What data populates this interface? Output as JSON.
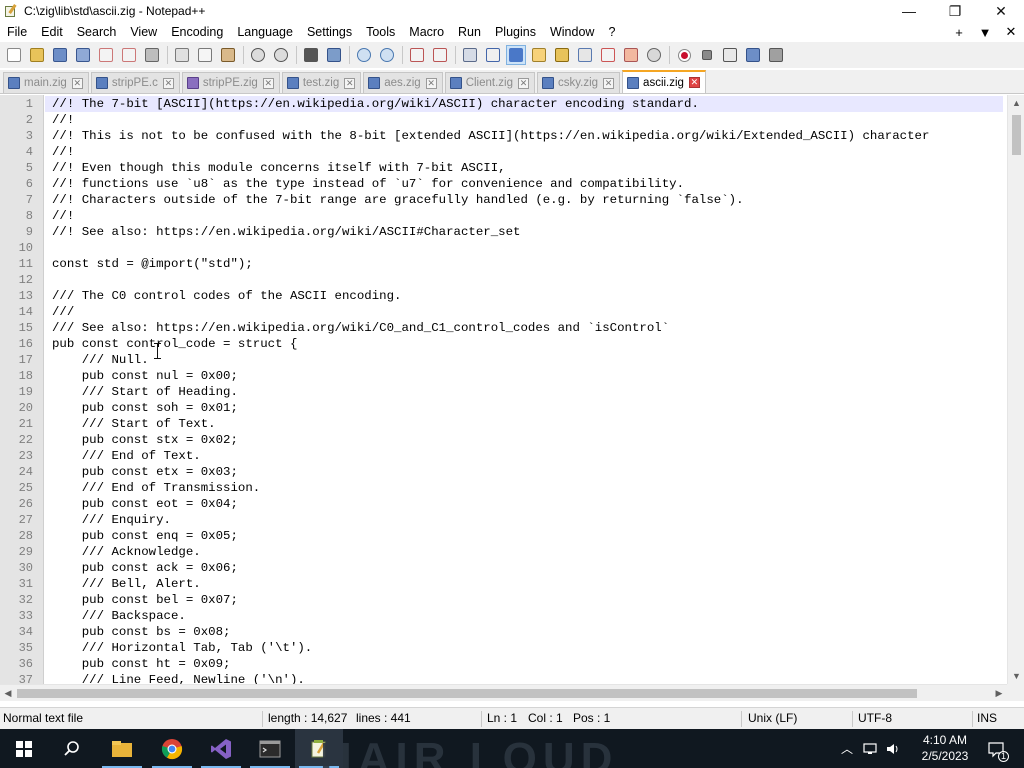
{
  "window": {
    "title": "C:\\zig\\lib\\std\\ascii.zig - Notepad++",
    "minimize": "—",
    "maximize": "❐",
    "close": "✕"
  },
  "menu": {
    "items": [
      "File",
      "Edit",
      "Search",
      "View",
      "Encoding",
      "Language",
      "Settings",
      "Tools",
      "Macro",
      "Run",
      "Plugins",
      "Window",
      "?"
    ],
    "right": [
      "+",
      "▼",
      "✕"
    ]
  },
  "tabs": [
    {
      "label": "main.zig",
      "active": false
    },
    {
      "label": "stripPE.c",
      "active": false
    },
    {
      "label": "stripPE.zig",
      "active": false
    },
    {
      "label": "test.zig",
      "active": false
    },
    {
      "label": "aes.zig",
      "active": false
    },
    {
      "label": "Client.zig",
      "active": false
    },
    {
      "label": "csky.zig",
      "active": false
    },
    {
      "label": "ascii.zig",
      "active": true
    }
  ],
  "editor": {
    "current_line": 1,
    "lines": [
      "//! The 7-bit [ASCII](https://en.wikipedia.org/wiki/ASCII) character encoding standard.",
      "//!",
      "//! This is not to be confused with the 8-bit [extended ASCII](https://en.wikipedia.org/wiki/Extended_ASCII) character",
      "//!",
      "//! Even though this module concerns itself with 7-bit ASCII,",
      "//! functions use `u8` as the type instead of `u7` for convenience and compatibility.",
      "//! Characters outside of the 7-bit range are gracefully handled (e.g. by returning `false`).",
      "//!",
      "//! See also: https://en.wikipedia.org/wiki/ASCII#Character_set",
      "",
      "const std = @import(\"std\");",
      "",
      "/// The C0 control codes of the ASCII encoding.",
      "///",
      "/// See also: https://en.wikipedia.org/wiki/C0_and_C1_control_codes and `isControl`",
      "pub const control_code = struct {",
      "    /// Null.",
      "    pub const nul = 0x00;",
      "    /// Start of Heading.",
      "    pub const soh = 0x01;",
      "    /// Start of Text.",
      "    pub const stx = 0x02;",
      "    /// End of Text.",
      "    pub const etx = 0x03;",
      "    /// End of Transmission.",
      "    pub const eot = 0x04;",
      "    /// Enquiry.",
      "    pub const enq = 0x05;",
      "    /// Acknowledge.",
      "    pub const ack = 0x06;",
      "    /// Bell, Alert.",
      "    pub const bel = 0x07;",
      "    /// Backspace.",
      "    pub const bs = 0x08;",
      "    /// Horizontal Tab, Tab ('\\t').",
      "    pub const ht = 0x09;",
      "    /// Line Feed, Newline ('\\n')."
    ]
  },
  "status": {
    "file_type": "Normal text file",
    "length": "length : 14,627",
    "lines": "lines : 441",
    "ln": "Ln : 1",
    "col": "Col : 1",
    "pos": "Pos : 1",
    "eol": "Unix (LF)",
    "encoding": "UTF-8",
    "mode": "INS"
  },
  "taskbar": {
    "time": "4:10 AM",
    "date": "2/5/2023",
    "notification_count": "1",
    "watermark": "HAIR LOUD"
  },
  "icons": {
    "start": "windows-logo-icon",
    "search": "search-icon",
    "explorer": "folder-icon",
    "chrome": "chrome-icon",
    "visual_studio": "visual-studio-icon",
    "terminal": "terminal-icon",
    "notepadpp": "notepadpp-icon"
  },
  "colors": {
    "accent_tab": "#f5a623",
    "record": "#c8102e",
    "taskbar": "#101820"
  }
}
